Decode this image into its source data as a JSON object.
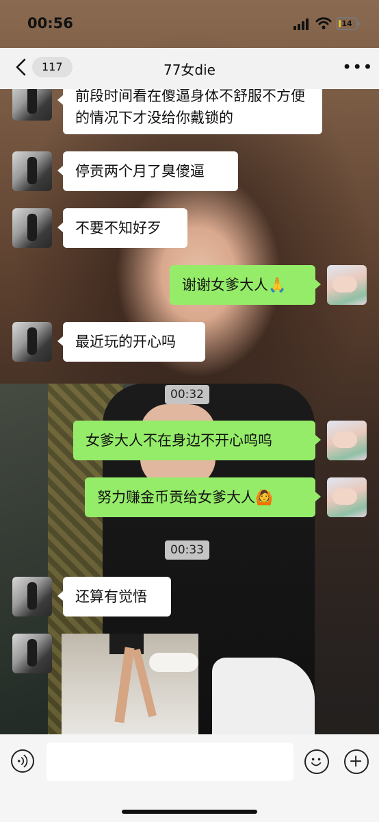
{
  "status_bar": {
    "time": "00:56",
    "battery": "14",
    "battery_level": 0.14
  },
  "header": {
    "back_count": "117",
    "title": "77女die",
    "more_icon": "ellipsis-icon"
  },
  "messages": [
    {
      "side": "left",
      "text": "前段时间看在傻逼身体不舒服不方便的情况下才没给你戴锁的"
    },
    {
      "side": "left",
      "text": "停贡两个月了臭傻逼"
    },
    {
      "side": "left",
      "text": "不要不知好歹"
    },
    {
      "side": "right",
      "text": "谢谢女爹大人🙏"
    },
    {
      "side": "left",
      "text": "最近玩的开心吗"
    },
    {
      "type": "time",
      "text": "00:32"
    },
    {
      "side": "right",
      "text": "女爹大人不在身边不开心呜呜"
    },
    {
      "side": "right",
      "text": "努力赚金币贡给女爹大人🙆"
    },
    {
      "type": "time",
      "text": "00:33"
    },
    {
      "side": "left",
      "text": "还算有觉悟"
    },
    {
      "side": "left",
      "type": "image"
    }
  ],
  "input_bar": {
    "placeholder": "",
    "icons": [
      "voice-icon",
      "emoji-icon",
      "plus-icon"
    ]
  }
}
